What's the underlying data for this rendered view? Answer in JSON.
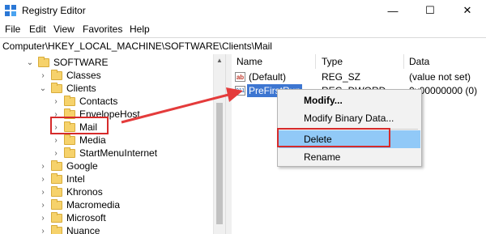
{
  "window": {
    "title": "Registry Editor",
    "minimize": "—",
    "maximize": "☐",
    "close": "✕"
  },
  "menu": [
    "File",
    "Edit",
    "View",
    "Favorites",
    "Help"
  ],
  "address": "Computer\\HKEY_LOCAL_MACHINE\\SOFTWARE\\Clients\\Mail",
  "tree": {
    "software": "SOFTWARE",
    "classes": "Classes",
    "clients": "Clients",
    "contacts": "Contacts",
    "envelopehost": "EnvelopeHost",
    "mail": "Mail",
    "media": "Media",
    "startmenuinternet": "StartMenuInternet",
    "google": "Google",
    "intel": "Intel",
    "khronos": "Khronos",
    "macromedia": "Macromedia",
    "microsoft": "Microsoft",
    "nuance": "Nuance"
  },
  "list": {
    "headers": {
      "name": "Name",
      "type": "Type",
      "data": "Data"
    },
    "rows": [
      {
        "name": "(Default)",
        "type": "REG_SZ",
        "data": "(value not set)",
        "icon": "ab"
      },
      {
        "name": "PreFirstRun",
        "type": "REG_DWORD",
        "data": "0x00000000 (0)",
        "icon": "binary"
      }
    ]
  },
  "context_menu": {
    "modify": "Modify...",
    "modify_binary": "Modify Binary Data...",
    "delete": "Delete",
    "rename": "Rename"
  },
  "colors": {
    "highlight": "#d62b2b",
    "selection": "#3d76d1",
    "menu_hover": "#91c9f7"
  }
}
